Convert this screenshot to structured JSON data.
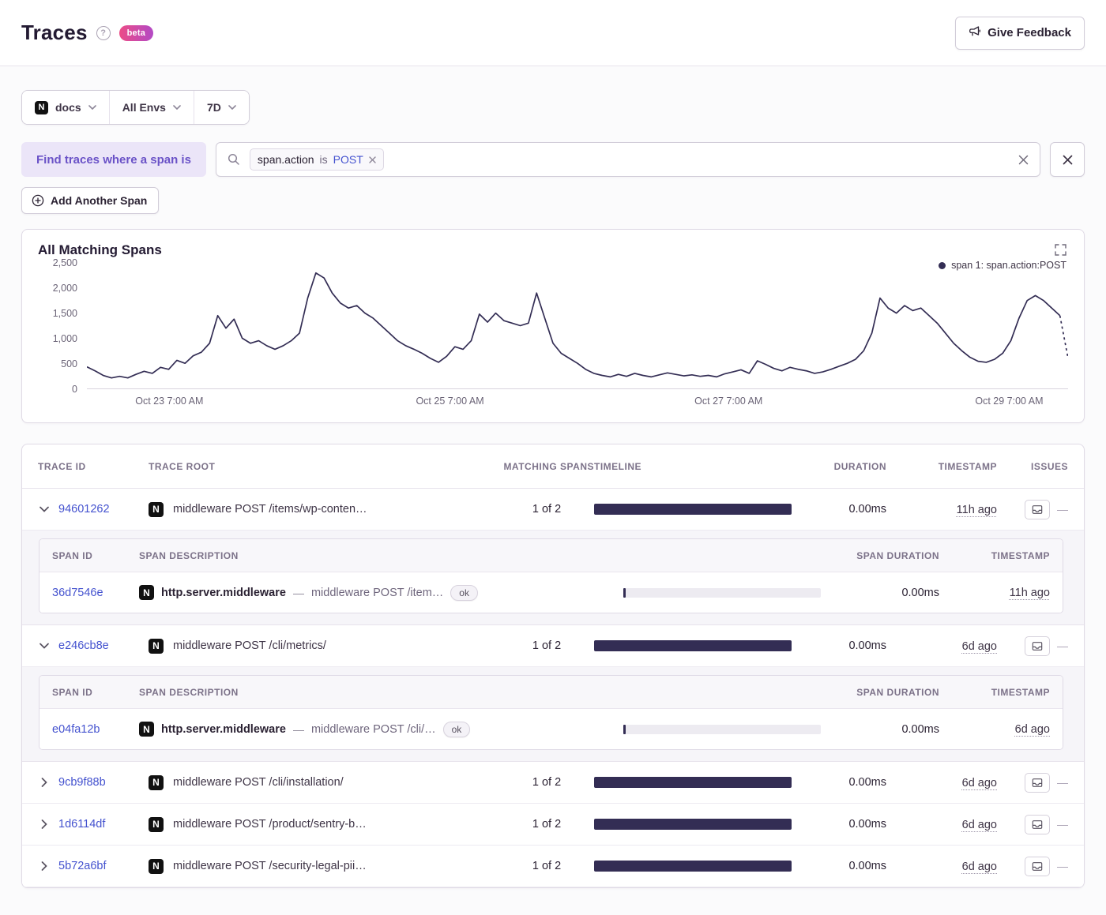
{
  "colors": {
    "link_blue": "#4452cf",
    "accent_purple": "#6a52c7",
    "bar_navy": "#332d54",
    "beta_gradient_start": "#ec4c87",
    "beta_gradient_end": "#b34ac5"
  },
  "header": {
    "title": "Traces",
    "help_glyph": "?",
    "beta_label": "beta",
    "feedback_label": "Give Feedback"
  },
  "filters": {
    "project_label": "docs",
    "env_label": "All Envs",
    "period_label": "7D"
  },
  "search": {
    "where_label": "Find traces where a span is",
    "token_key": "span.action",
    "token_op": "is",
    "token_value": "POST",
    "add_span_label": "Add Another Span"
  },
  "project_icon_letter": "N",
  "chart_data": {
    "type": "line",
    "title": "All Matching Spans",
    "series": [
      {
        "name": "span 1: span.action:POST",
        "color": "#332d54",
        "values": [
          430,
          350,
          260,
          210,
          240,
          210,
          280,
          340,
          300,
          420,
          380,
          560,
          500,
          650,
          720,
          900,
          1450,
          1200,
          1380,
          1000,
          900,
          950,
          850,
          780,
          850,
          950,
          1100,
          1800,
          2300,
          2200,
          1900,
          1700,
          1600,
          1650,
          1500,
          1400,
          1250,
          1100,
          950,
          850,
          780,
          700,
          600,
          520,
          640,
          830,
          780,
          950,
          1480,
          1320,
          1500,
          1350,
          1300,
          1250,
          1300,
          1900,
          1400,
          900,
          700,
          600,
          500,
          380,
          300,
          260,
          230,
          280,
          240,
          300,
          260,
          230,
          270,
          310,
          280,
          250,
          270,
          240,
          260,
          230,
          290,
          330,
          370,
          300,
          550,
          480,
          400,
          350,
          420,
          380,
          350,
          300,
          330,
          380,
          440,
          500,
          580,
          750,
          1100,
          1800,
          1600,
          1500,
          1650,
          1550,
          1600,
          1450,
          1300,
          1100,
          900,
          750,
          620,
          540,
          520,
          580,
          700,
          950,
          1400,
          1750,
          1850,
          1750,
          1600,
          1450,
          600
        ]
      }
    ],
    "xticks": [
      "Oct 23 7:00 AM",
      "Oct 25 7:00 AM",
      "Oct 27 7:00 AM",
      "Oct 29 7:00 AM"
    ],
    "xtick_fractions": [
      0.084,
      0.37,
      0.654,
      0.94
    ],
    "yticks": [
      "2,500",
      "2,000",
      "1,500",
      "1,000",
      "500",
      "0"
    ],
    "ylim": [
      0,
      2500
    ],
    "grid": false,
    "legend_position": "top-right",
    "dashed_tail_points": 1
  },
  "table": {
    "columns": [
      "TRACE ID",
      "TRACE ROOT",
      "MATCHING SPANS",
      "TIMELINE",
      "DURATION",
      "TIMESTAMP",
      "ISSUES"
    ],
    "span_columns": [
      "SPAN ID",
      "SPAN DESCRIPTION",
      "SPAN DURATION",
      "TIMESTAMP"
    ],
    "desc_separator": "—",
    "issues_placeholder": "—",
    "rows": [
      {
        "id": "94601262",
        "root": "middleware POST /items/wp-conten…",
        "matching": "1 of 2",
        "duration": "0.00ms",
        "timestamp": "11h ago",
        "expanded": true,
        "span": {
          "id": "36d7546e",
          "op": "http.server.middleware",
          "desc": "middleware POST /item…",
          "status": "ok",
          "duration": "0.00ms",
          "timestamp": "11h ago"
        }
      },
      {
        "id": "e246cb8e",
        "root": "middleware POST /cli/metrics/",
        "matching": "1 of 2",
        "duration": "0.00ms",
        "timestamp": "6d ago",
        "expanded": true,
        "span": {
          "id": "e04fa12b",
          "op": "http.server.middleware",
          "desc": "middleware POST /cli/…",
          "status": "ok",
          "duration": "0.00ms",
          "timestamp": "6d ago"
        }
      },
      {
        "id": "9cb9f88b",
        "root": "middleware POST /cli/installation/",
        "matching": "1 of 2",
        "duration": "0.00ms",
        "timestamp": "6d ago",
        "expanded": false
      },
      {
        "id": "1d6114df",
        "root": "middleware POST /product/sentry-b…",
        "matching": "1 of 2",
        "duration": "0.00ms",
        "timestamp": "6d ago",
        "expanded": false
      },
      {
        "id": "5b72a6bf",
        "root": "middleware POST /security-legal-pii…",
        "matching": "1 of 2",
        "duration": "0.00ms",
        "timestamp": "6d ago",
        "expanded": false
      }
    ]
  }
}
